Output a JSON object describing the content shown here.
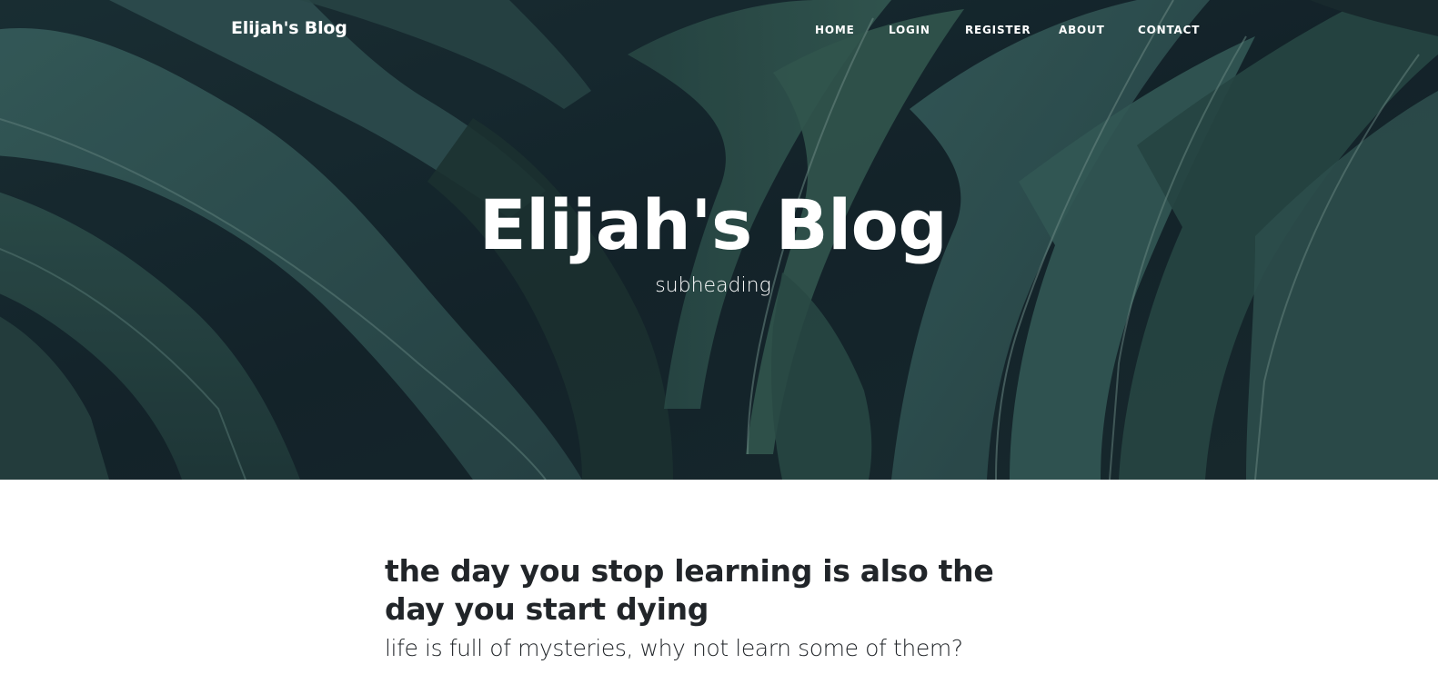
{
  "navbar": {
    "brand": "Elijah's Blog",
    "links": [
      {
        "label": "HOME"
      },
      {
        "label": "LOGIN"
      },
      {
        "label": "REGISTER"
      },
      {
        "label": "ABOUT"
      },
      {
        "label": "CONTACT"
      }
    ]
  },
  "header": {
    "title": "Elijah's Blog",
    "subheading": "subheading",
    "background": "fern-leaves-image"
  },
  "posts": [
    {
      "title": "the day you stop learning is also the day you start dying",
      "subtitle": "life is full of mysteries, why not learn some of them?"
    }
  ],
  "colors": {
    "nav_text": "#ffffff",
    "heading_text": "#ffffff",
    "post_text": "#212529",
    "hero_dark": "#182c31",
    "leaf_green": "#3d6a63"
  }
}
